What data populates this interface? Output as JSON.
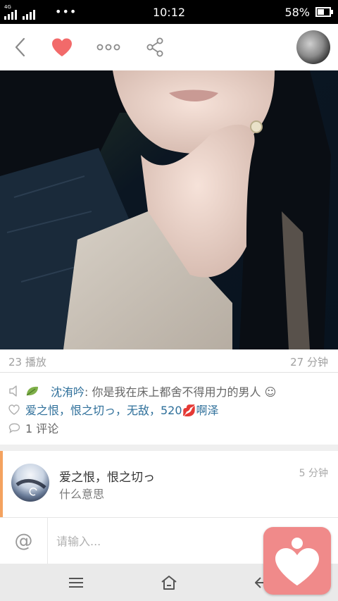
{
  "status_bar": {
    "network": "4G",
    "dots": "•••",
    "time": "10:12",
    "battery_text": "58%",
    "battery_level": 0.58
  },
  "nav": {
    "icons": [
      "back-icon",
      "heart-icon",
      "more-icon",
      "share-icon"
    ],
    "accent_color": "#f26a6a"
  },
  "post": {
    "plays": "23 播放",
    "time": "27 分钟",
    "author_name": "沈洧吟",
    "caption": ": 你是我在床上都舍不得用力的男人 ☺",
    "likers": "爱之恨，恨之切っ，无敌，520💋啊泽",
    "comments_count": "1 评论"
  },
  "comment": {
    "user": "爱之恨，恨之切っ",
    "time": "5 分钟",
    "text": "什么意思"
  },
  "input": {
    "at_symbol": "@",
    "placeholder": "请输入..."
  },
  "colors": {
    "link": "#2e6f9a",
    "comment_accent": "#f4a25f",
    "fab": "#f08a8a"
  }
}
